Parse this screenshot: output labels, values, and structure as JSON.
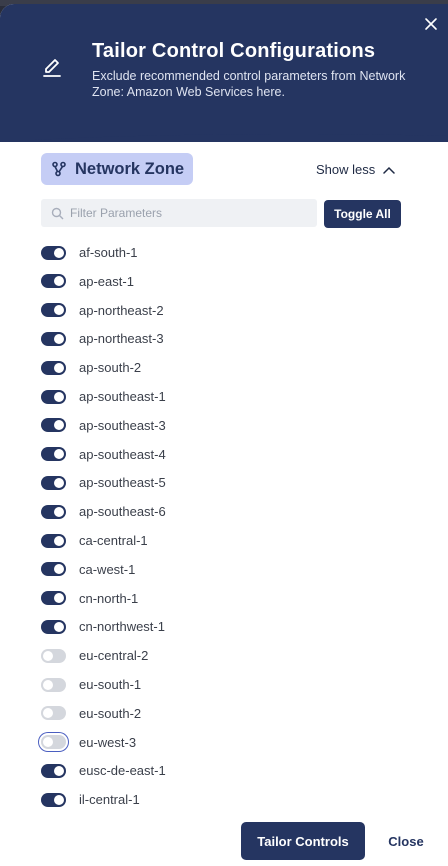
{
  "modal": {
    "title": "Tailor Control Configurations",
    "subtitle": "Exclude recommended control parameters from Network Zone: Amazon Web Services here.",
    "close_icon": "close-icon",
    "edit_icon": "pencil-icon"
  },
  "section": {
    "chip_label": "Network Zone",
    "chip_icon": "network-nodes-icon",
    "show_less_label": "Show less",
    "filter_placeholder": "Filter Parameters",
    "filter_value": "",
    "toggle_all_label": "Toggle All"
  },
  "parameters": [
    {
      "label": "af-south-1",
      "enabled": true
    },
    {
      "label": "ap-east-1",
      "enabled": true
    },
    {
      "label": "ap-northeast-2",
      "enabled": true
    },
    {
      "label": "ap-northeast-3",
      "enabled": true
    },
    {
      "label": "ap-south-2",
      "enabled": true
    },
    {
      "label": "ap-southeast-1",
      "enabled": true
    },
    {
      "label": "ap-southeast-3",
      "enabled": true
    },
    {
      "label": "ap-southeast-4",
      "enabled": true
    },
    {
      "label": "ap-southeast-5",
      "enabled": true
    },
    {
      "label": "ap-southeast-6",
      "enabled": true
    },
    {
      "label": "ca-central-1",
      "enabled": true
    },
    {
      "label": "ca-west-1",
      "enabled": true
    },
    {
      "label": "cn-north-1",
      "enabled": true
    },
    {
      "label": "cn-northwest-1",
      "enabled": true
    },
    {
      "label": "eu-central-2",
      "enabled": false
    },
    {
      "label": "eu-south-1",
      "enabled": false
    },
    {
      "label": "eu-south-2",
      "enabled": false
    },
    {
      "label": "eu-west-3",
      "enabled": false,
      "focused": true
    },
    {
      "label": "eusc-de-east-1",
      "enabled": true
    },
    {
      "label": "il-central-1",
      "enabled": true
    }
  ],
  "footer": {
    "primary_label": "Tailor Controls",
    "secondary_label": "Close"
  },
  "colors": {
    "header_bg": "#253561",
    "accent": "#253561",
    "chip_bg": "#c5cdf5",
    "toggle_off": "#d4d7dd"
  }
}
